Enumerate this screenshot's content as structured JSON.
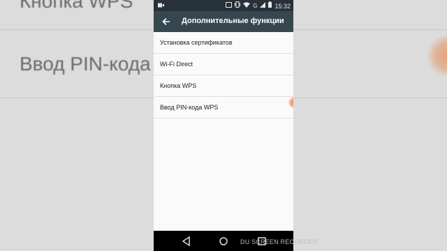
{
  "background": {
    "row_top": "Кнопка WPS",
    "row_main": "Ввод PIN-кода"
  },
  "statusbar": {
    "time": "15:32",
    "network": "G",
    "icons": [
      "camera-icon",
      "cast-icon",
      "vibrate-icon",
      "wifi-icon",
      "signal-icon",
      "battery-icon"
    ]
  },
  "appbar": {
    "back_icon": "arrow-back-icon",
    "title": "Дополнительные функции"
  },
  "list": {
    "items": [
      {
        "label": "Установка сертификатов"
      },
      {
        "label": "Wi-Fi Direct"
      },
      {
        "label": "Кнопка WPS"
      },
      {
        "label": "Ввод PIN-кода WPS"
      }
    ]
  },
  "navbar": {
    "icons": [
      "back-triangle-icon",
      "home-circle-icon",
      "recents-square-icon"
    ]
  },
  "watermark": "DU SCREEN RECORDER",
  "colors": {
    "statusbar": "#263238",
    "appbar": "#37474f",
    "list_bg": "#fafafa",
    "touch_indicator": "#e8895a"
  }
}
